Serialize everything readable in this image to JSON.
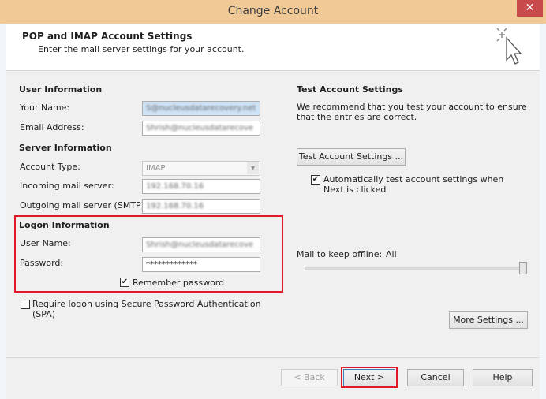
{
  "window": {
    "title": "Change Account",
    "close_glyph": "✕"
  },
  "header": {
    "title": "POP and IMAP Account Settings",
    "subtitle": "Enter the mail server settings for your account."
  },
  "user_info": {
    "heading": "User Information",
    "your_name_label": "Your Name:",
    "your_name_value": "S@nucleusdatarecovery.net",
    "email_label": "Email Address:",
    "email_value": "Shrish@nucleusdatarecove"
  },
  "server_info": {
    "heading": "Server Information",
    "account_type_label": "Account Type:",
    "account_type_value": "IMAP",
    "incoming_label": "Incoming mail server:",
    "incoming_value": "192.168.70.16",
    "outgoing_label": "Outgoing mail server (SMTP):",
    "outgoing_value": "192.168.70.16"
  },
  "logon_info": {
    "heading": "Logon Information",
    "username_label": "User Name:",
    "username_value": "Shrish@nucleusdatarecove",
    "password_label": "Password:",
    "password_value": "*************",
    "remember_label": "Remember password",
    "remember_checked": true
  },
  "spa": {
    "label": "Require logon using Secure Password Authentication (SPA)",
    "checked": false
  },
  "test_settings": {
    "heading": "Test Account Settings",
    "description": "We recommend that you test your account to ensure that the entries are correct.",
    "button_label": "Test Account Settings ...",
    "auto_test_label": "Automatically test account settings when Next is clicked",
    "auto_test_checked": true
  },
  "offline": {
    "label": "Mail to keep offline:",
    "value": "All"
  },
  "more_settings_label": "More Settings ...",
  "footer": {
    "back_label": "< Back",
    "next_label": "Next >",
    "cancel_label": "Cancel",
    "help_label": "Help"
  },
  "colors": {
    "highlight": "#e0182a",
    "titlebar": "#f0c997"
  },
  "icons": {
    "wizard": "cursor-sparkle-icon",
    "checkmark": "✔",
    "dropdown": "▾"
  }
}
